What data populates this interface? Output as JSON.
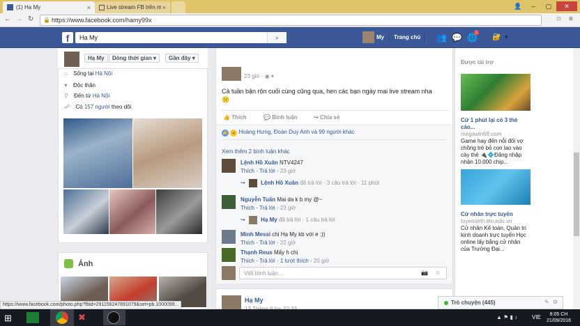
{
  "browser": {
    "tabs": [
      {
        "title": "(1) Hạ My"
      },
      {
        "title": "Live stream FB trên máy"
      }
    ],
    "url": "https://www.facebook.com/hamy99x",
    "status_url": "https://www.facebook.com/photo.php?fbid=291156247891079&set=pb.1000099..."
  },
  "fb_header": {
    "logo": "f",
    "search_value": "Hạ My",
    "profile_name": "My",
    "home": "Trang chủ",
    "notif_badge": "1"
  },
  "cover_bar": {
    "name": "Hạ My",
    "timeline": "Dòng thời gian",
    "recent": "Gần đây"
  },
  "intro": {
    "lives_label": "Sống tại",
    "lives_city": "Hà Nội",
    "single": "Độc thân",
    "from_label": "Đến từ",
    "from_city": "Hà Nội",
    "followers_pre": "Có",
    "followers_count": "157 người",
    "followers_post": "theo dõi"
  },
  "photos_section": {
    "title": "Ảnh"
  },
  "post": {
    "time": "23 giờ",
    "text": "Cả tuần bận rộn cuối cùng cũng qua, hen các bạn ngày mai live stream nha",
    "emoji": "😕",
    "actions": {
      "like": "Thích",
      "comment": "Bình luận",
      "share": "Chia sẻ"
    },
    "reactions": "Hoàng Hưng, Đoàn Duy Anh và 99 người khác",
    "more_comments": "Xem thêm 2 bình luận khác",
    "comments": [
      {
        "author": "Lệnh Hồ Xuân",
        "text": "NTV4247",
        "like": "Thích",
        "reply": "Trả lời",
        "time": "23 giờ",
        "sub_author": "Lệnh Hồ Xuân",
        "sub_text": "đã trả lời · 3 câu trả lời · 11 phút"
      },
      {
        "author": "Nguyễn Tuấn",
        "text": "Mai da k b my @~",
        "like": "Thích",
        "reply": "Trả lời",
        "time": "23 giờ",
        "sub_author": "Hạ My",
        "sub_text": "đã trả lời · 1 câu trả lời"
      },
      {
        "author": "Minh Messi",
        "text": "chị Hạ My kb với e :))",
        "like": "Thích",
        "reply": "Trả lời",
        "time": "22 giờ"
      },
      {
        "author": "Thạnh Reus",
        "text": "Mấy h chị",
        "like": "Thích",
        "reply": "Trả lời",
        "extra": "1 lượt thích",
        "time": "20 giờ"
      }
    ],
    "write_placeholder": "Viết bình luận..."
  },
  "post2": {
    "author": "Hạ My",
    "time": "13 Tháng 9 lúc 22:33"
  },
  "sponsored": {
    "title": "Được tài trợ",
    "ads": [
      {
        "headline": "Cứ 1 phút lại có 3 thẻ cào...",
        "domain": "megawin68.com",
        "body": "Game hay đến nỗi đối vợ chồng trẻ bỏ con lao vào cày thẻ 🔌💠Đăng nhập nhận 10.000 chip..."
      },
      {
        "headline": "Cử nhân trực tuyến",
        "domain": "tuyensinh.elo.edu.vn",
        "body": "Cử nhân Kế toán, Quản trị kinh doanh trực tuyến Học online lấy bằng cử nhân của Trường Đại..."
      }
    ]
  },
  "chat": {
    "label": "Trò chuyện (445)"
  },
  "taskbar": {
    "lang": "VIE",
    "time": "8:05 CH",
    "date": "21/09/2016"
  }
}
